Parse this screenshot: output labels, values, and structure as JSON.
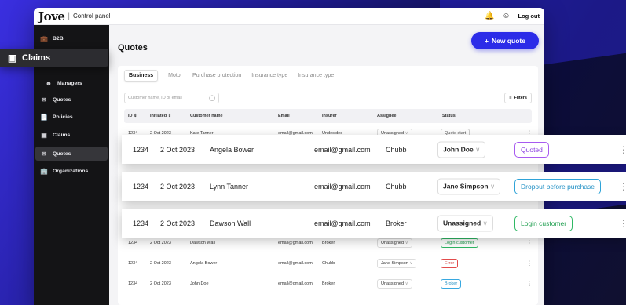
{
  "brand": {
    "logo": "Jove",
    "panel": "Control panel"
  },
  "topbar": {
    "logout": "Log out"
  },
  "sidebar": {
    "items": [
      {
        "label": "B2B",
        "icon": "briefcase-icon"
      },
      {
        "label": "Managers",
        "icon": "users-icon"
      },
      {
        "label": "Quotes",
        "icon": "mail-icon"
      },
      {
        "label": "Policies",
        "icon": "document-icon"
      },
      {
        "label": "Claims",
        "icon": "claims-icon"
      },
      {
        "label": "Quotes",
        "icon": "mail-icon",
        "active": true
      },
      {
        "label": "Organizations",
        "icon": "building-icon"
      }
    ]
  },
  "claims_popup": {
    "label": "Claims"
  },
  "page": {
    "title": "Quotes",
    "new_quote": "New quote"
  },
  "tabs": [
    "Business",
    "Motor",
    "Purchase protection",
    "Insurance type",
    "Insurance type"
  ],
  "search": {
    "placeholder": "Customer name, ID or email"
  },
  "filters_label": "Filters",
  "columns": [
    "ID",
    "Initiated",
    "Customer name",
    "Email",
    "Insurer",
    "Assignee",
    "Status"
  ],
  "rows": [
    {
      "id": "1234",
      "date": "2 Oct 2023",
      "name": "Kate Tanner",
      "email": "email@gmail.com",
      "insurer": "Undecided",
      "assignee": "Unassigned",
      "status": "Quote start",
      "status_class": "st-quote-start"
    },
    {
      "id": "1234",
      "date": "2 Oct 2023",
      "name": "Angela Bower",
      "email": "email@gmail.com",
      "insurer": "Chubb",
      "assignee": "John Doe",
      "status": "Quoted",
      "status_class": "st-quoted"
    },
    {
      "id": "1234",
      "date": "2 Oct 2023",
      "name": "Dawson Wall",
      "email": "email@gmail.com",
      "insurer": "Broker",
      "assignee": "Unassigned",
      "status": "Login customer",
      "status_class": "st-login"
    },
    {
      "id": "1234",
      "date": "2 Oct 2023",
      "name": "Angela Bower",
      "email": "email@gmail.com",
      "insurer": "Chubb",
      "assignee": "Jane Simpson",
      "status": "Error",
      "status_class": "st-error"
    },
    {
      "id": "1234",
      "date": "2 Oct 2023",
      "name": "John Doe",
      "email": "email@gmail.com",
      "insurer": "Broker",
      "assignee": "Unassigned",
      "status": "Broker",
      "status_class": "st-broker"
    }
  ],
  "floating_rows": [
    {
      "id": "1234",
      "date": "2 Oct 2023",
      "name": "Angela Bower",
      "email": "email@gmail.com",
      "insurer": "Chubb",
      "assignee": "John Doe",
      "status": "Quoted",
      "status_class": "st-quoted"
    },
    {
      "id": "1234",
      "date": "2 Oct 2023",
      "name": "Lynn Tanner",
      "email": "email@gmail.com",
      "insurer": "Chubb",
      "assignee": "Jane Simpson",
      "status": "Dropout before purchase",
      "status_class": "st-dropout"
    },
    {
      "id": "1234",
      "date": "2 Oct 2023",
      "name": "Dawson Wall",
      "email": "email@gmail.com",
      "insurer": "Broker",
      "assignee": "Unassigned",
      "status": "Login customer",
      "status_class": "st-login"
    }
  ]
}
